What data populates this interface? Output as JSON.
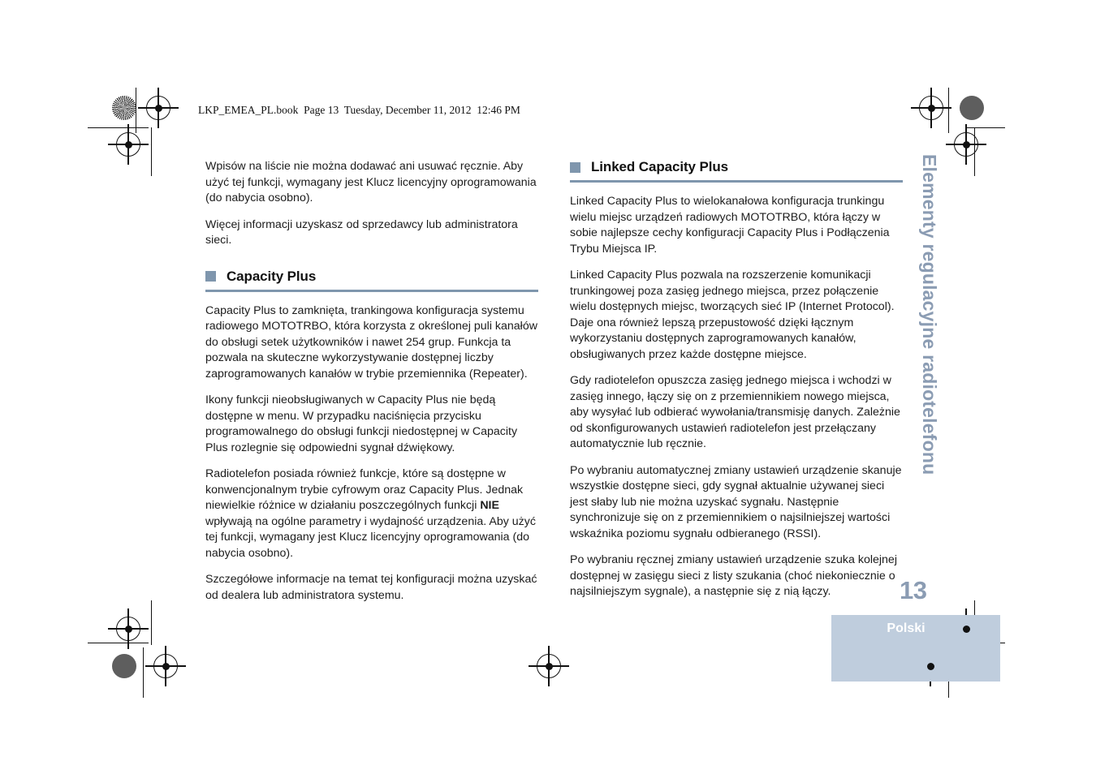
{
  "document": {
    "file_header": "LKP_EMEA_PL.book  Page 13  Tuesday, December 11, 2012  12:46 PM",
    "page_number": "13",
    "language_band": "Polski",
    "side_title": "Elementy regulacyjne radiotelefonu",
    "accent_color": "#7f96ad",
    "sidebar_text_color": "#8b9cb3",
    "band_color": "#bfcddd"
  },
  "left_column": {
    "intro_paragraphs": [
      "Wpisów na liście nie można dodawać ani usuwać ręcznie. Aby użyć tej funkcji, wymagany jest Klucz licencyjny oprogramowania (do nabycia osobno).",
      "Więcej informacji uzyskasz od sprzedawcy lub administratora sieci."
    ],
    "section": {
      "heading": "Capacity Plus",
      "paragraphs": [
        "Capacity Plus to zamknięta, trankingowa konfiguracja systemu radiowego MOTOTRBO, która korzysta z określonej puli kanałów do obsługi setek użytkowników i nawet 254 grup. Funkcja ta pozwala na skuteczne wykorzystywanie dostępnej liczby zaprogramowanych kanałów w trybie przemiennika (Repeater).",
        "Ikony funkcji nieobsługiwanych w Capacity Plus nie będą dostępne w menu. W przypadku naciśnięcia przycisku programowalnego do obsługi funkcji niedostępnej w Capacity Plus rozlegnie się odpowiedni sygnał dźwiękowy."
      ],
      "paragraph_with_bold": {
        "before": "Radiotelefon posiada również funkcje, które są dostępne w konwencjonalnym trybie cyfrowym oraz Capacity Plus. Jednak niewielkie różnice w działaniu poszczególnych funkcji ",
        "bold": "NIE",
        "after": " wpływają na ogólne parametry i wydajność urządzenia. Aby użyć tej funkcji, wymagany jest Klucz licencyjny oprogramowania (do nabycia osobno)."
      },
      "closing_paragraph": "Szczegółowe informacje na temat tej konfiguracji można uzyskać od dealera lub administratora systemu."
    }
  },
  "right_column": {
    "section": {
      "heading": "Linked Capacity Plus",
      "paragraphs": [
        "Linked Capacity Plus to wielokanałowa konfiguracja trunkingu wielu miejsc urządzeń radiowych MOTOTRBO, która łączy w sobie najlepsze cechy konfiguracji Capacity Plus i Podłączenia Trybu Miejsca IP.",
        "Linked Capacity Plus pozwala na rozszerzenie komunikacji trunkingowej poza zasięg jednego miejsca, przez połączenie wielu dostępnych miejsc, tworzących sieć  IP (Internet Protocol).  Daje ona również lepszą przepustowość dzięki łącznym wykorzystaniu dostępnych zaprogramowanych kanałów, obsługiwanych przez każde dostępne miejsce.",
        "Gdy radiotelefon opuszcza zasięg jednego miejsca i wchodzi w zasięg innego, łączy się on z przemiennikiem nowego miejsca, aby wysyłać lub odbierać wywołania/transmisję danych. Zależnie od skonfigurowanych ustawień radiotelefon jest przełączany automatycznie lub ręcznie.",
        "Po wybraniu automatycznej zmiany ustawień urządzenie skanuje wszystkie dostępne sieci, gdy sygnał aktualnie używanej sieci jest słaby lub nie można uzyskać sygnału. Następnie synchronizuje się on z przemiennikiem o najsilniejszej wartości wskaźnika poziomu sygnału odbieranego (RSSI).",
        "Po wybraniu ręcznej zmiany ustawień urządzenie szuka kolejnej dostępnej w zasięgu sieci z listy szukania (choć niekoniecznie o najsilniejszym sygnale), a następnie się z nią łączy."
      ]
    }
  }
}
